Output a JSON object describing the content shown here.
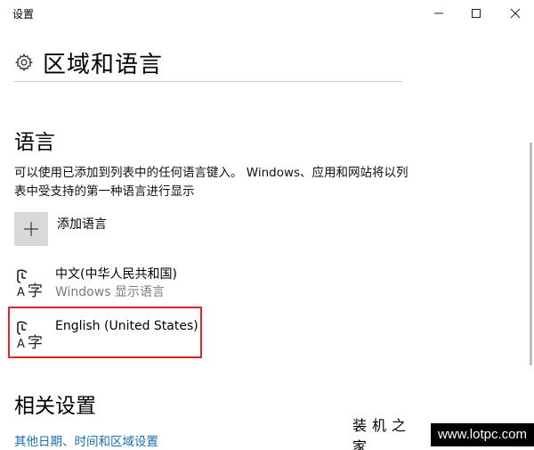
{
  "window": {
    "title": "设置",
    "minimize_glyph": "—",
    "maximize_glyph": "☐",
    "close_glyph": "✕"
  },
  "header": {
    "title": "区域和语言",
    "icon": "gear-icon"
  },
  "language_section": {
    "title": "语言",
    "description": "可以使用已添加到列表中的任何语言键入。 Windows、应用和网站将以列表中受支持的第一种语言进行显示",
    "add_label": "添加语言",
    "items": [
      {
        "name": "中文(中华人民共和国)",
        "subtitle": "Windows 显示语言",
        "icon": "language-icon"
      },
      {
        "name": "English (United States)",
        "subtitle": "",
        "icon": "language-icon",
        "highlighted": true
      }
    ]
  },
  "related_section": {
    "title": "相关设置",
    "link": "其他日期、时间和区域设置"
  },
  "watermark": {
    "text_cn": "装机之家",
    "url": "www.lotpc.com"
  },
  "colors": {
    "highlight_border": "#e0262a",
    "link": "#1a6fb5",
    "plus_box": "#d9d9d9",
    "secondary_text": "#7a7a7a"
  }
}
